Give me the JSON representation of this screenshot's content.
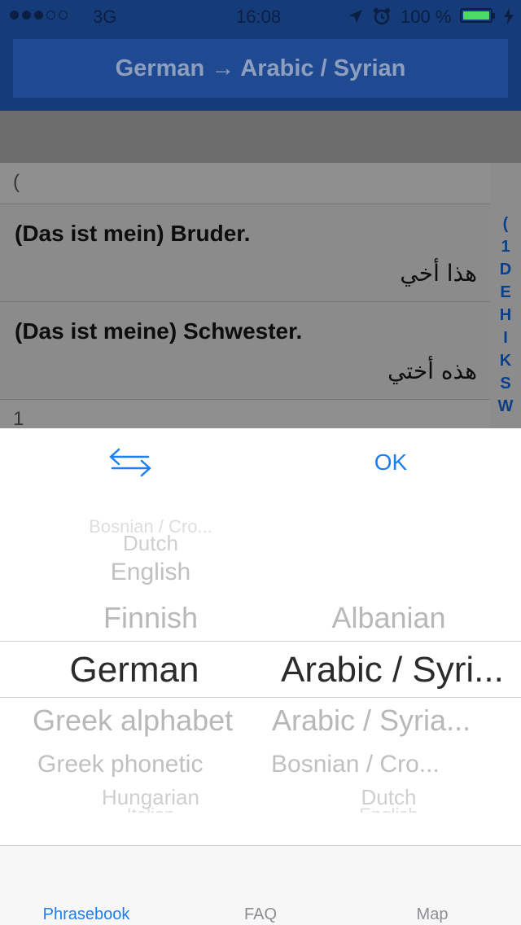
{
  "status": {
    "carrier": "3G",
    "time": "16:08",
    "battery": "100 %",
    "signal_bars_filled": 3,
    "signal_bars_total": 5
  },
  "nav": {
    "title": "German → Arabic / Syrian"
  },
  "list": {
    "section_open": "(",
    "rows": [
      {
        "german": "(Das ist mein) Bruder.",
        "arabic": "هذا أخي"
      },
      {
        "german": "(Das ist meine) Schwester.",
        "arabic": "هذه أختي"
      }
    ],
    "section_next": "1",
    "index": [
      "(",
      "1",
      "D",
      "E",
      "H",
      "I",
      "K",
      "S",
      "W"
    ]
  },
  "picker": {
    "ok_label": "OK",
    "source_column": {
      "above": [
        "Bosnian / Cro...",
        "Dutch",
        "English",
        "Finnish"
      ],
      "selected": "German",
      "below": [
        "Greek alphabet",
        "Greek phonetic",
        "Hungarian",
        "Italian"
      ]
    },
    "target_column": {
      "above": [
        "Albanian"
      ],
      "selected": "Arabic / Syri...",
      "below": [
        "Arabic / Syria...",
        "Bosnian / Cro...",
        "Dutch",
        "English"
      ]
    }
  },
  "tabs": {
    "phrasebook": "Phrasebook",
    "faq": "FAQ",
    "map": "Map"
  },
  "colors": {
    "nav_background": "#163b79",
    "accent_blue": "#1a7ff2",
    "battery_green": "#4cd964"
  },
  "icons": {
    "location": "location-arrow-icon",
    "alarm": "alarm-clock-icon",
    "charging": "charging-bolt-icon",
    "swap": "swap-arrows-icon"
  }
}
